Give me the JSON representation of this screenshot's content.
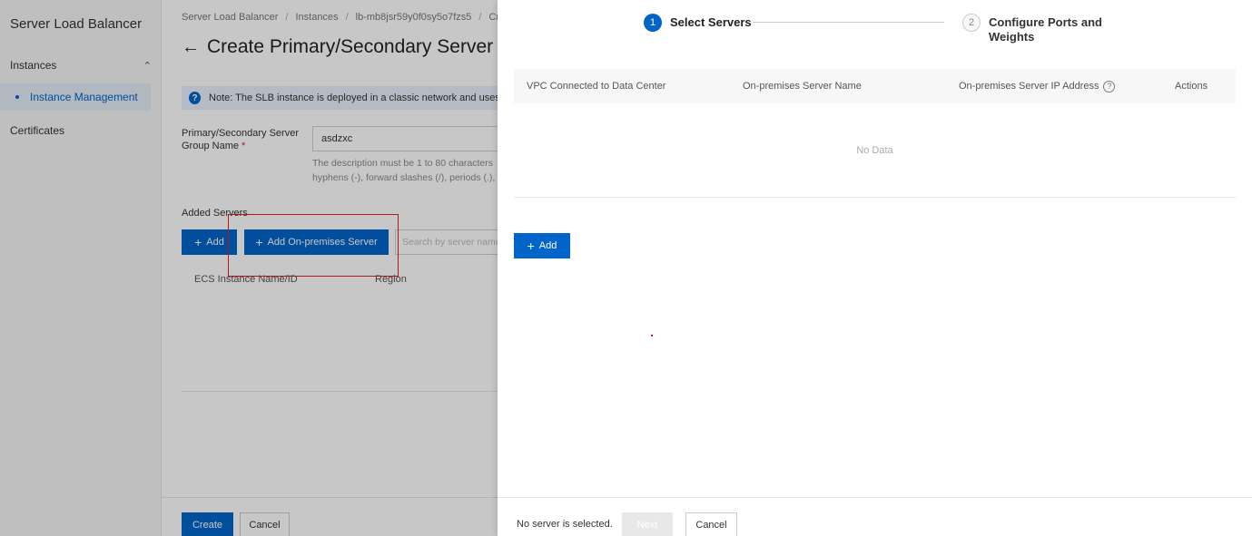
{
  "sidebar": {
    "title": "Server Load Balancer",
    "group_label": "Instances",
    "active_item": "Instance Management",
    "certificates": "Certificates"
  },
  "main": {
    "breadcrumb": [
      "Server Load Balancer",
      "Instances",
      "lb-mb8jsr59y0f0sy5o7fzs5",
      "Cr"
    ],
    "back_arrow": "←",
    "title": "Create Primary/Secondary Server",
    "note": "Note: The SLB instance is deployed in a classic network and uses a",
    "form_label": "Primary/Secondary Server Group Name",
    "required_mark": "*",
    "name_value": "asdzxc",
    "help_line1": "The description must be 1 to 80 characters",
    "help_line2": "hyphens (-), forward slashes (/), periods (.),",
    "added_servers_label": "Added Servers",
    "add_label": "Add",
    "add_onprem_label": "Add On-premises Server",
    "search_placeholder": "Search by server name",
    "table_headers": [
      "ECS Instance Name/ID",
      "Region"
    ],
    "create_label": "Create",
    "cancel_label": "Cancel"
  },
  "drawer": {
    "step1_number": "1",
    "step1_label": "Select Servers",
    "step2_number": "2",
    "step2_label": "Configure Ports and Weights",
    "table_headers": [
      "VPC Connected to Data Center",
      "On-premises Server Name",
      "On-premises Server IP Address",
      "Actions"
    ],
    "help_icon": "?",
    "empty_text": "No Data",
    "add_label": "Add",
    "status_text": "No server is selected.",
    "next_label": "Next",
    "cancel_label": "Cancel"
  },
  "colors": {
    "primary": "#0064c8",
    "highlight": "#e02020",
    "sidebar_bg": "#f5f5f5"
  },
  "icons": {
    "collapse": "chevron-up-icon",
    "back": "arrow-left-icon",
    "note": "question-circle-icon",
    "plus": "plus-icon"
  }
}
